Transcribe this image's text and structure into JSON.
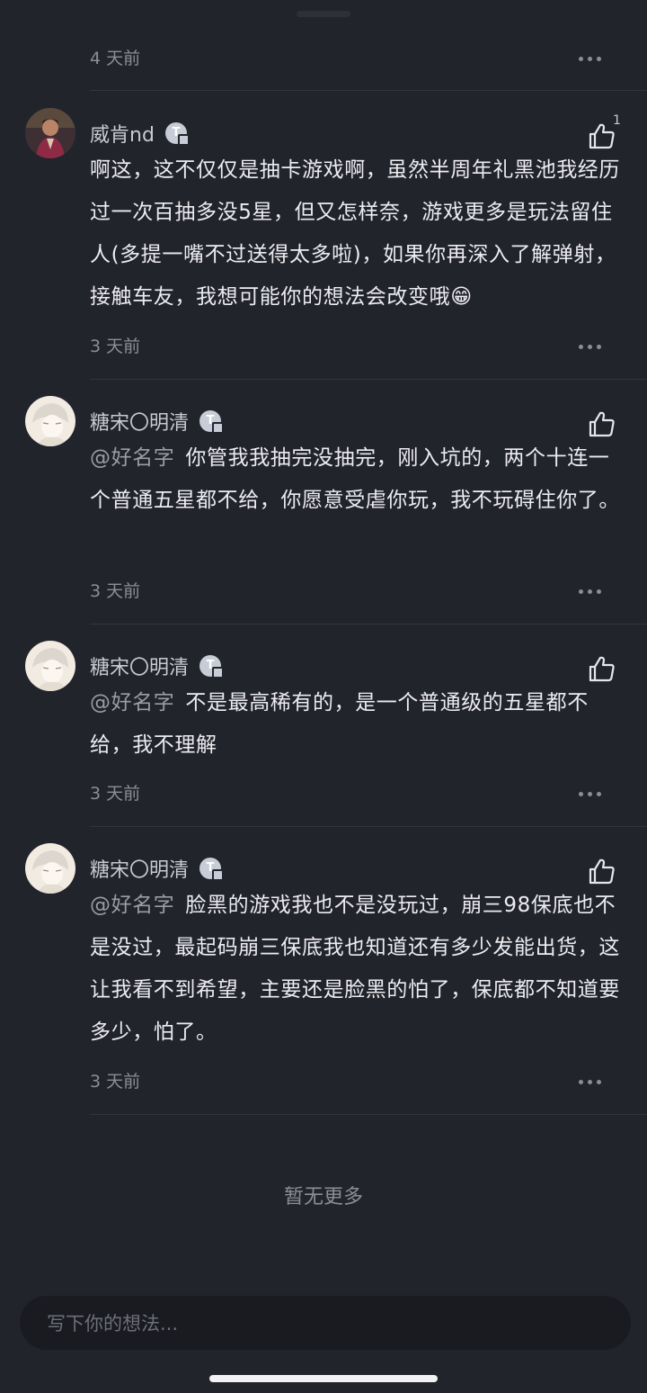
{
  "top_item": {
    "time": "4 天前"
  },
  "comments": [
    {
      "name": "威肯nd",
      "likes": "1",
      "mention": "",
      "text": "啊这，这不仅仅是抽卡游戏啊，虽然半周年礼黑池我经历过一次百抽多没5星，但又怎样奈，游戏更多是玩法留住人(多提一嘴不过送得太多啦)，如果你再深入了解弹射，接触车友，我想可能你的想法会改变哦😁",
      "time": "3 天前"
    },
    {
      "name": "糖宋〇明清",
      "likes": "",
      "mention": "@好名字",
      "text": "你管我我抽完没抽完，刚入坑的，两个十连一个普通五星都不给，你愿意受虐你玩，我不玩碍住你了。",
      "time": "3 天前"
    },
    {
      "name": "糖宋〇明清",
      "likes": "",
      "mention": "@好名字",
      "text": "不是最高稀有的，是一个普通级的五星都不给，我不理解",
      "time": "3 天前"
    },
    {
      "name": "糖宋〇明清",
      "likes": "",
      "mention": "@好名字",
      "text": "脸黑的游戏我也不是没玩过，崩三98保底也不是没过，最起码崩三保底我也知道还有多少发能出货，这让我看不到希望，主要还是脸黑的怕了，保底都不知道要多少，怕了。",
      "time": "3 天前"
    }
  ],
  "empty_text": "暂无更多",
  "input": {
    "placeholder": "写下你的想法..."
  },
  "icons": {
    "like": "thumbs-up-icon",
    "more": "more-horizontal-icon",
    "badge": "user-level-badge-icon"
  },
  "colors": {
    "background": "#22242c",
    "input_bg": "#191b20",
    "muted": "#8c8e96"
  }
}
